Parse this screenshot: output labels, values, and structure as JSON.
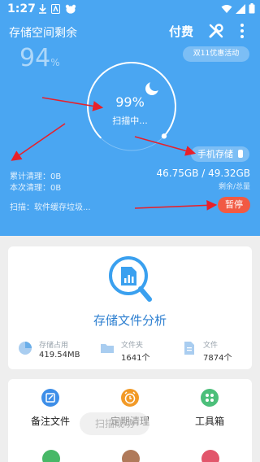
{
  "status_bar": {
    "time": "1:27"
  },
  "header": {
    "title": "存储空间剩余",
    "pay_label": "付费"
  },
  "remaining": {
    "value": "94",
    "unit": "%"
  },
  "promo_label": "双11优惠活动",
  "scan": {
    "percent": "99%",
    "status": "扫描中...",
    "progress": 0.99,
    "current": "扫描：软件缓存垃圾..."
  },
  "phone_storage_label": "手机存储",
  "cleanup": {
    "total": "累计清理：0B",
    "this_time": "本次清理：0B"
  },
  "storage": {
    "value": "46.75GB / 49.32GB",
    "label": "剩余/总量"
  },
  "pause_label": "暂停",
  "analysis": {
    "title": "存储文件分析",
    "metrics": [
      {
        "label": "存储占用",
        "value": "419.54MB"
      },
      {
        "label": "文件夹",
        "value": "1641个"
      },
      {
        "label": "文件",
        "value": "7874个"
      }
    ]
  },
  "tools": [
    {
      "label": "备注文件"
    },
    {
      "label": "定期清理"
    },
    {
      "label": "工具箱"
    }
  ],
  "toast": "扫描成功",
  "colors": {
    "primary": "#4aa6f2",
    "accent": "#f15a43",
    "title_blue": "#2d7fd0",
    "annotation_red": "#e8202a"
  }
}
